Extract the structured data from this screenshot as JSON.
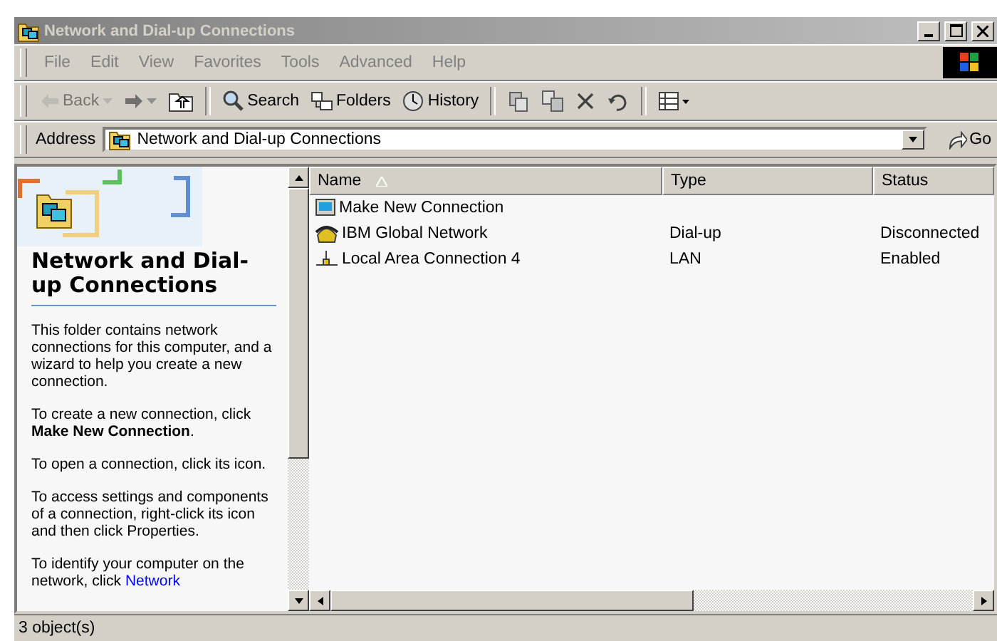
{
  "window": {
    "title": "Network and Dial-up Connections"
  },
  "menu": [
    "File",
    "Edit",
    "View",
    "Favorites",
    "Tools",
    "Advanced",
    "Help"
  ],
  "toolbar": [
    {
      "kind": "back",
      "label": "Back",
      "disabled": true
    },
    {
      "kind": "forward",
      "disabled": false
    },
    {
      "kind": "up",
      "disabled": false
    },
    {
      "kind": "search",
      "label": "Search",
      "disabled": false
    },
    {
      "kind": "folders",
      "label": "Folders",
      "disabled": false
    },
    {
      "kind": "history",
      "label": "History",
      "disabled": false
    },
    {
      "kind": "move",
      "disabled": false
    },
    {
      "kind": "copy",
      "disabled": false
    },
    {
      "kind": "delete",
      "disabled": false
    },
    {
      "kind": "undo",
      "disabled": false
    },
    {
      "kind": "views",
      "disabled": false
    }
  ],
  "address": {
    "label": "Address",
    "value": "Network and Dial-up Connections",
    "go": "Go"
  },
  "left_pane": {
    "heading": "Network and Dial-up Connections",
    "paragraphs": [
      {
        "text": "This folder contains network connections for this computer, and a wizard to help you create a new connection."
      },
      {
        "text": "To create a new connection, click **Make New Connection**."
      },
      {
        "text": "To open a connection, click its icon."
      },
      {
        "text": "To access settings and components of a connection, right-click its icon and then click Properties."
      },
      {
        "text": "To identify your computer on the network, click ",
        "link": "Network"
      }
    ]
  },
  "table": {
    "columns": [
      {
        "label": "Name",
        "sorted": true
      },
      {
        "label": "Type",
        "sorted": false
      },
      {
        "label": "Status",
        "sorted": false
      }
    ],
    "rows": [
      {
        "kind": "wizard",
        "name": "Make New Connection"
      },
      {
        "kind": "dialup",
        "name": "IBM Global Network",
        "type": "Dial-up",
        "status": "Disconnected"
      },
      {
        "kind": "lan",
        "name": "Local Area Connection 4",
        "type": "LAN",
        "status": "Enabled"
      }
    ]
  },
  "status_bar": {
    "text": "3 object(s)"
  }
}
